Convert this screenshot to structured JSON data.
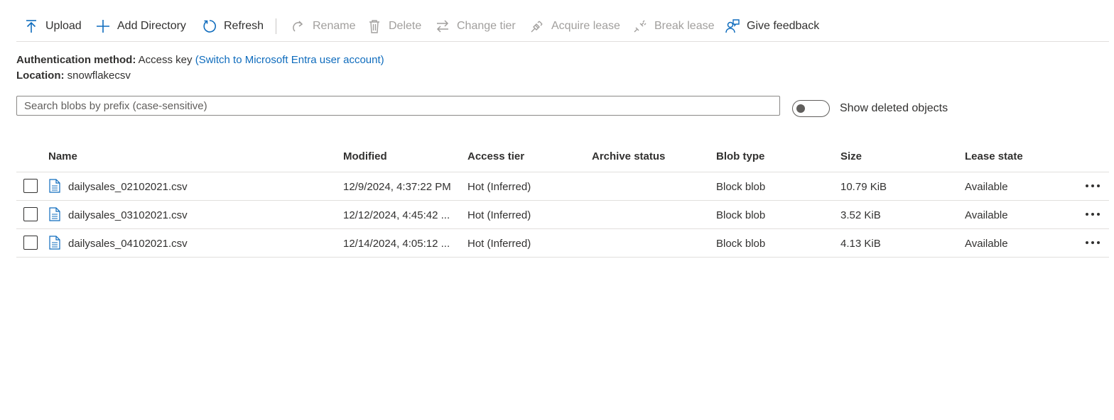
{
  "toolbar": {
    "upload": "Upload",
    "add_directory": "Add Directory",
    "refresh": "Refresh",
    "rename": "Rename",
    "delete": "Delete",
    "change_tier": "Change tier",
    "acquire_lease": "Acquire lease",
    "break_lease": "Break lease",
    "give_feedback": "Give feedback"
  },
  "auth": {
    "label": "Authentication method:",
    "value": "Access key",
    "switch_link": "(Switch to Microsoft Entra user account)"
  },
  "location": {
    "label": "Location:",
    "value": "snowflakecsv"
  },
  "search": {
    "placeholder": "Search blobs by prefix (case-sensitive)",
    "value": ""
  },
  "show_deleted": {
    "label": "Show deleted objects",
    "on": false
  },
  "table": {
    "columns": [
      "Name",
      "Modified",
      "Access tier",
      "Archive status",
      "Blob type",
      "Size",
      "Lease state"
    ],
    "rows": [
      {
        "name": "dailysales_02102021.csv",
        "modified": "12/9/2024, 4:37:22 PM",
        "access_tier": "Hot (Inferred)",
        "archive_status": "",
        "blob_type": "Block blob",
        "size": "10.79 KiB",
        "lease_state": "Available"
      },
      {
        "name": "dailysales_03102021.csv",
        "modified": "12/12/2024, 4:45:42 ...",
        "access_tier": "Hot (Inferred)",
        "archive_status": "",
        "blob_type": "Block blob",
        "size": "3.52 KiB",
        "lease_state": "Available"
      },
      {
        "name": "dailysales_04102021.csv",
        "modified": "12/14/2024, 4:05:12 ...",
        "access_tier": "Hot (Inferred)",
        "archive_status": "",
        "blob_type": "Block blob",
        "size": "4.13 KiB",
        "lease_state": "Available"
      }
    ]
  },
  "colors": {
    "accent": "#0f6cbd",
    "disabled": "#a19f9d",
    "text": "#323130"
  }
}
